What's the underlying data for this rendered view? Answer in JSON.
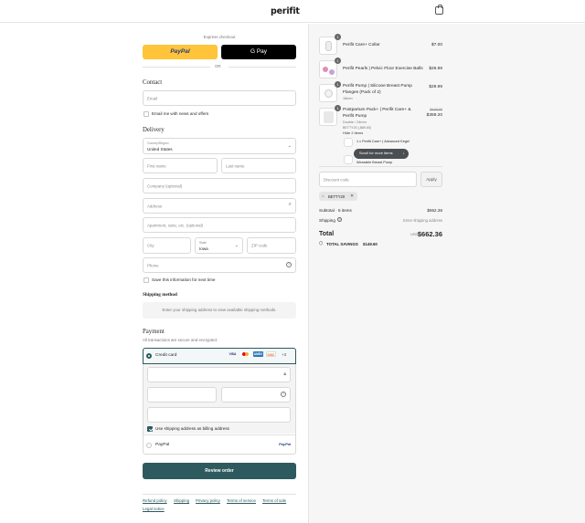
{
  "header": {
    "brand": "perifit",
    "cart_icon": "shopping-bag-icon"
  },
  "express": {
    "title": "Express checkout",
    "paypal": "PayPal",
    "gpay": "G Pay",
    "or": "OR"
  },
  "contact": {
    "title": "Contact",
    "email_placeholder": "Email",
    "newsletter": "Email me with news and offers"
  },
  "delivery": {
    "title": "Delivery",
    "country_label": "Country/Region",
    "country_value": "United States",
    "first_name": "First name",
    "last_name": "Last name",
    "company": "Company (optional)",
    "address": "Address",
    "apartment": "Apartment, suite, etc. (optional)",
    "city": "City",
    "state_label": "State",
    "state_value": "Iowa",
    "zip": "ZIP code",
    "phone": "Phone",
    "save_info": "Save this information for next time"
  },
  "shipping_method": {
    "title": "Shipping method",
    "message": "Enter your shipping address to view available shipping methods."
  },
  "payment": {
    "title": "Payment",
    "subtitle": "All transactions are secure and encrypted.",
    "credit_card": "Credit card",
    "more_cards": "+3",
    "billing_same": "Use shipping address as billing address",
    "paypal": "PayPal",
    "paypal_logo": "PayPal",
    "cards": [
      "VISA",
      "MC",
      "AMEX",
      "DISC"
    ]
  },
  "review_button": "Review order",
  "footer_links": [
    "Refund policy",
    "Shipping",
    "Privacy policy",
    "Terms of service",
    "Terms of sale",
    "Legal notice"
  ],
  "cart": {
    "items": [
      {
        "qty": "1",
        "name": "Perifit Care+ Collar",
        "price": "$7.00"
      },
      {
        "qty": "1",
        "name": "Perifit Pearls | Pelvic Floor Exercise Balls",
        "price": "$26.99"
      },
      {
        "qty": "1",
        "name": "Perifit Pump | Silicone Breast Pump",
        "name2": "Flanges (Pack of 2)",
        "variant": "18mm",
        "price": "$29.99"
      },
      {
        "qty": "1",
        "name": "Postpartum Pack+ | Perifit Care+ &",
        "name2": "Perifit Pump",
        "variant": "Double / 24mm",
        "discount": "BETTY20 (-$89.60)",
        "old_price": "$448.00",
        "price": "$359.20",
        "hide": "Hide 2 items",
        "sub1": "1 x Perifit Care+ | Advanced Kegel",
        "sub2": "Wearable Breast Pump"
      }
    ],
    "scroll_hint": "Scroll for more items",
    "discount_placeholder": "Discount code",
    "apply": "Apply",
    "code_tag": "BETTY20",
    "subtotal_label": "Subtotal · 5 items",
    "subtotal": "$662.36",
    "shipping_label": "Shipping",
    "shipping_value": "Enter shipping address",
    "total_label": "Total",
    "currency": "USD",
    "total": "$662.36",
    "savings_label": "TOTAL SAVINGS",
    "savings": "$149.60"
  }
}
